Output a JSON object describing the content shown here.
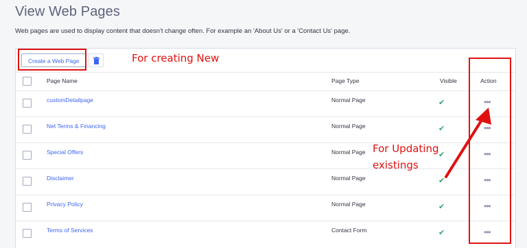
{
  "header": {
    "title": "View Web Pages",
    "subtitle": "Web pages are used to display content that doesn't change often. For example an 'About Us' or a 'Contact Us' page."
  },
  "toolbar": {
    "create_label": "Create a Web Page",
    "delete_icon": "trash-icon"
  },
  "table": {
    "columns": {
      "name": "Page Name",
      "type": "Page Type",
      "visible": "Visible",
      "action": "Action"
    },
    "rows": [
      {
        "name": "customDetailpage",
        "type": "Normal Page",
        "visible": true,
        "action": "•••"
      },
      {
        "name": "Net Terms & Financing",
        "type": "Normal Page",
        "visible": true,
        "action": "•••"
      },
      {
        "name": "Special Offers",
        "type": "Normal Page",
        "visible": true,
        "action": "•••"
      },
      {
        "name": "Disclaimer",
        "type": "Normal Page",
        "visible": true,
        "action": "•••"
      },
      {
        "name": "Privacy Policy",
        "type": "Normal Page",
        "visible": true,
        "action": "•••"
      },
      {
        "name": "Terms of Services",
        "type": "Contact Form",
        "visible": true,
        "action": "•••"
      }
    ]
  },
  "annotations": {
    "creating": "For creating New",
    "updating_line1": "For Updating",
    "updating_line2": "existings",
    "color": "#e01010"
  },
  "colors": {
    "link": "#3c64f4",
    "check": "#2fa36b",
    "delete": "#3c64f4"
  }
}
